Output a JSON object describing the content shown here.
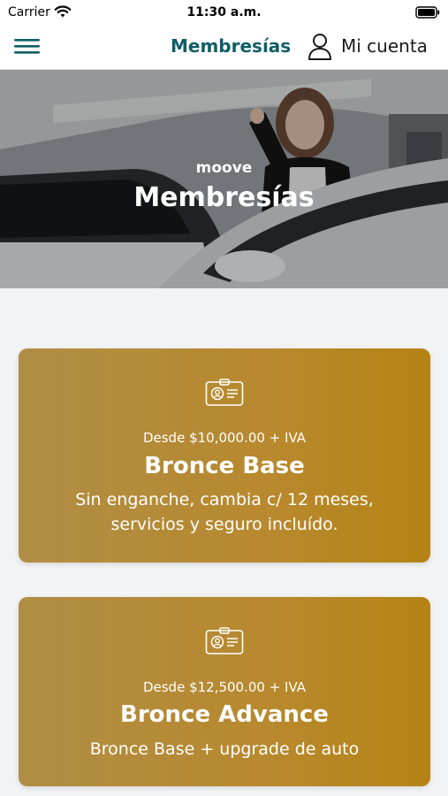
{
  "status_bar": {
    "carrier": "Carrier",
    "time": "11:30 a.m."
  },
  "nav": {
    "title": "Membresías",
    "account_label": "Mi cuenta"
  },
  "hero": {
    "brand": "moove",
    "title": "Membresías"
  },
  "memberships": [
    {
      "icon": "id-card-icon",
      "price": "Desde $10,000.00 + IVA",
      "name": "Bronce Base",
      "description": "Sin enganche, cambia c/ 12 meses, servicios y seguro incluído."
    },
    {
      "icon": "id-card-icon",
      "price": "Desde $12,500.00 + IVA",
      "name": "Bronce Advance",
      "description": "Bronce Base + upgrade de auto"
    }
  ],
  "colors": {
    "nav_title": "#0f5e66",
    "card_gold": "#b58314"
  }
}
